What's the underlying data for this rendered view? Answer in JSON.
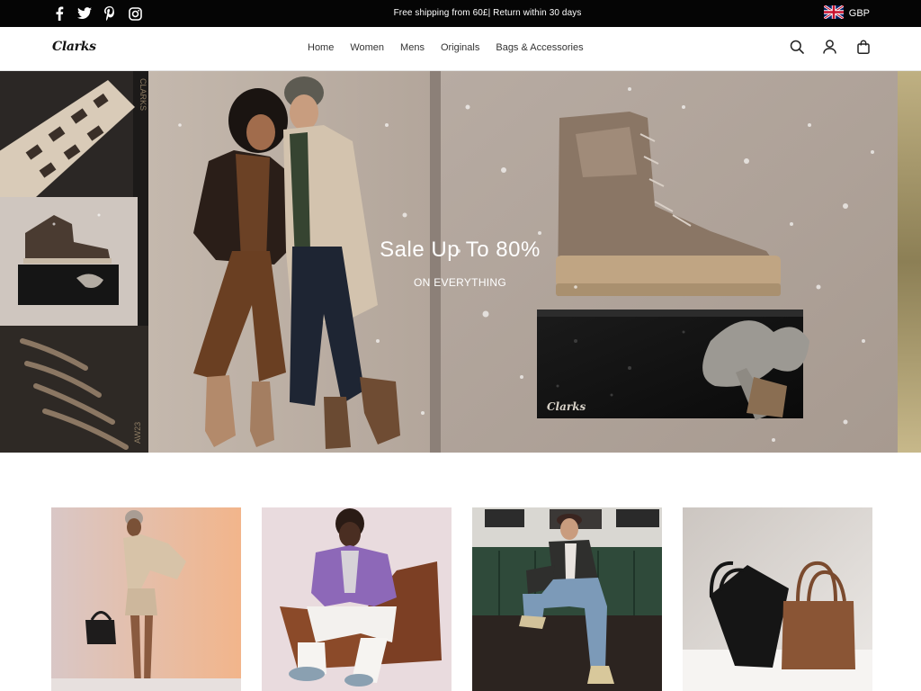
{
  "topbar": {
    "social": [
      {
        "icon": "facebook-icon",
        "glyph": "f"
      },
      {
        "icon": "twitter-icon",
        "glyph": "t"
      },
      {
        "icon": "pinterest-icon",
        "glyph": "p"
      },
      {
        "icon": "instagram-icon",
        "glyph": "i"
      }
    ],
    "announcement": "Free shipping from 60£| Return within 30 days",
    "currency": "GBP",
    "currency_flag": "uk-flag-icon"
  },
  "header": {
    "logo": "Clarks",
    "nav": [
      "Home",
      "Women",
      "Mens",
      "Originals",
      "Bags & Accessories"
    ],
    "actions": [
      "search-icon",
      "account-icon",
      "cart-icon"
    ]
  },
  "hero": {
    "title": "Sale Up To 80%",
    "subtitle": "ON EVERYTHING",
    "box_brand": "Clarks",
    "side_text_top": "CLARKS",
    "side_text_bottom": "AW23"
  },
  "tiles": [
    {
      "name": "women-category-tile",
      "image": "woman-with-handbag"
    },
    {
      "name": "men-category-tile",
      "image": "man-in-purple-cardigan"
    },
    {
      "name": "originals-category-tile",
      "image": "man-on-green-sofa"
    },
    {
      "name": "bags-category-tile",
      "image": "leather-tote-bags"
    }
  ],
  "colors": {
    "topbar_bg": "#050505",
    "hero_bg": "#b3a59b",
    "text": "#333333"
  }
}
